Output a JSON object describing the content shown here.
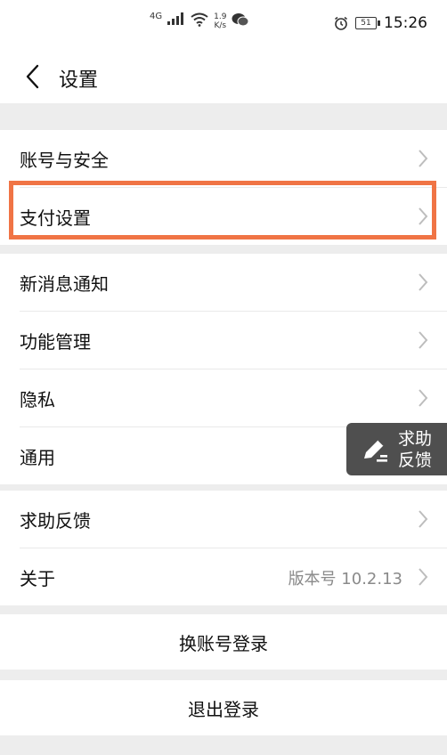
{
  "status_bar": {
    "network": "4G",
    "speed_value": "1.9",
    "speed_unit": "K/s",
    "battery": "51",
    "time": "15:26"
  },
  "nav": {
    "title": "设置"
  },
  "groups": {
    "g1": [
      {
        "label": "账号与安全"
      },
      {
        "label": "支付设置"
      }
    ],
    "g2": [
      {
        "label": "新消息通知"
      },
      {
        "label": "功能管理"
      },
      {
        "label": "隐私"
      },
      {
        "label": "通用"
      }
    ],
    "g3": [
      {
        "label": "求助反馈"
      },
      {
        "label": "关于",
        "value": "版本号 10.2.13"
      }
    ]
  },
  "actions": {
    "switch_account": "换账号登录",
    "logout": "退出登录"
  },
  "floating_help": {
    "line1": "求助",
    "line2": "反馈"
  },
  "colors": {
    "highlight": "#f07445",
    "background": "#ededed",
    "floating": "#4f4f4f"
  }
}
